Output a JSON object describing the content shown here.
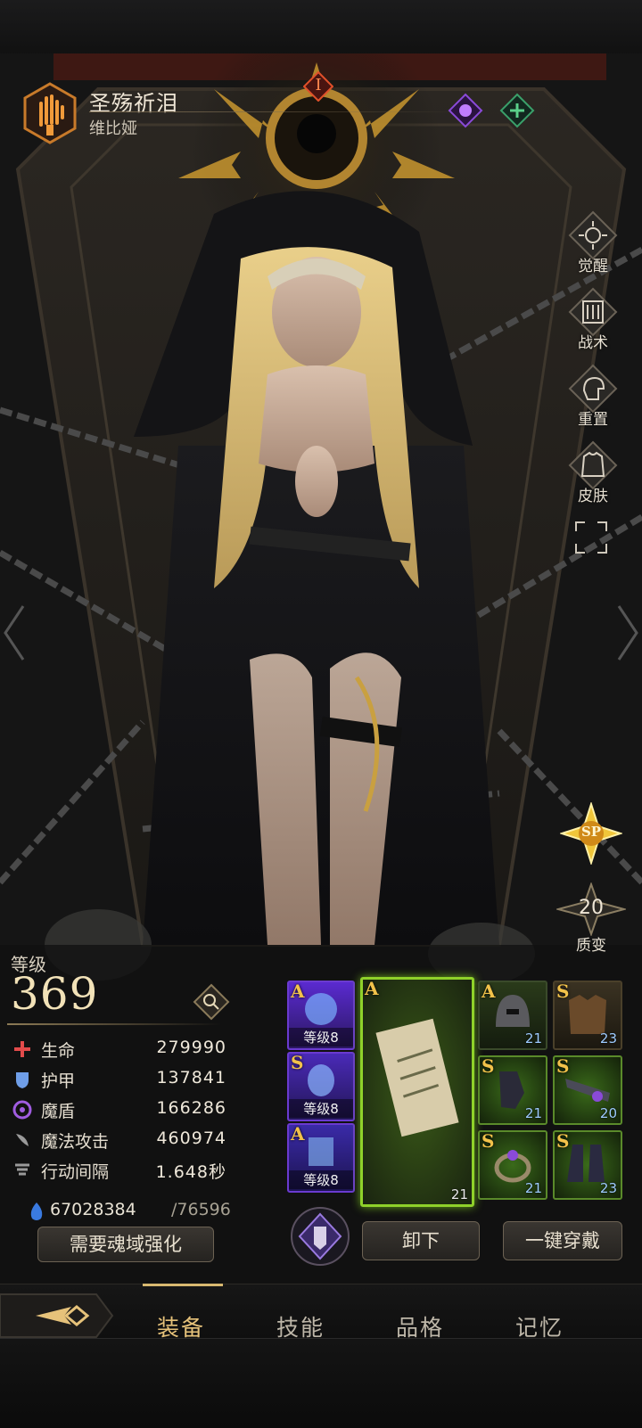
{
  "header": {
    "name": "圣殇祈泪",
    "subtitle": "维比娅",
    "rank_badge": "I"
  },
  "side_buttons": [
    {
      "label": "觉醒",
      "icon": "awaken-icon"
    },
    {
      "label": "战术",
      "icon": "tactics-icon"
    },
    {
      "label": "重置",
      "icon": "reset-icon"
    },
    {
      "label": "皮肤",
      "icon": "skin-icon"
    }
  ],
  "sp_badge": "SP",
  "quality": {
    "value": "20",
    "label": "质变"
  },
  "level": {
    "label": "等级",
    "value": "369"
  },
  "stats": [
    {
      "label": "生命",
      "value": "279990",
      "icon": "health-icon",
      "color": "#e24b4b"
    },
    {
      "label": "护甲",
      "value": "137841",
      "icon": "armor-icon",
      "color": "#6f9ee8"
    },
    {
      "label": "魔盾",
      "value": "166286",
      "icon": "magic-shield-icon",
      "color": "#a05ce0"
    },
    {
      "label": "魔法攻击",
      "value": "460974",
      "icon": "magic-attack-icon",
      "color": "#9a9a9a"
    },
    {
      "label": "行动间隔",
      "value": "1.648秒",
      "icon": "action-interval-icon",
      "color": "#9a9a9a"
    }
  ],
  "soul": {
    "current": "67028384",
    "required": "/76596",
    "button": "需要魂域强化"
  },
  "relics": [
    {
      "grade": "A",
      "level": "等级8"
    },
    {
      "grade": "S",
      "level": "等级8"
    },
    {
      "grade": "A",
      "level": "等级8"
    }
  ],
  "main_item": {
    "grade": "A",
    "count": "21"
  },
  "gear": [
    {
      "grade": "A",
      "count": "21",
      "name": "helmet-icon"
    },
    {
      "grade": "S",
      "count": "23",
      "name": "armor-piece-icon"
    },
    {
      "grade": "S",
      "count": "21",
      "name": "gauntlet-icon"
    },
    {
      "grade": "S",
      "count": "20",
      "name": "weapon-icon"
    },
    {
      "grade": "S",
      "count": "21",
      "name": "ring-icon"
    },
    {
      "grade": "S",
      "count": "23",
      "name": "boots-icon"
    }
  ],
  "actions": {
    "unequip": "卸下",
    "equip_all": "一键穿戴"
  },
  "tabs": [
    "装备",
    "技能",
    "品格",
    "记忆"
  ],
  "colors": {
    "accent_gold": "#f2c24a",
    "active_tab": "#e6c27a",
    "card_green": "#8fd12a",
    "card_purple": "#6a3ad0"
  }
}
